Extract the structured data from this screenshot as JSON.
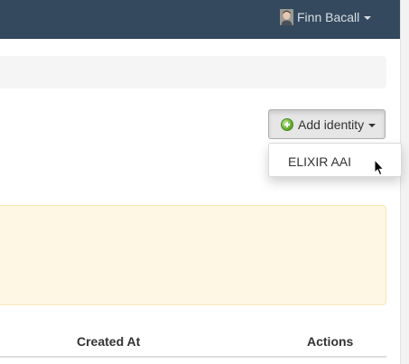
{
  "navbar": {
    "user_name": "Finn Bacall"
  },
  "identities": {
    "add_button_label": "Add identity",
    "dropdown_items": [
      "ELIXIR AAI"
    ]
  },
  "table": {
    "columns": [
      "Created At",
      "Actions"
    ]
  },
  "colors": {
    "navbar_bg": "#34495e",
    "alert_bg": "#fdf7e3",
    "button_active_bg": "#e6e6e6"
  }
}
